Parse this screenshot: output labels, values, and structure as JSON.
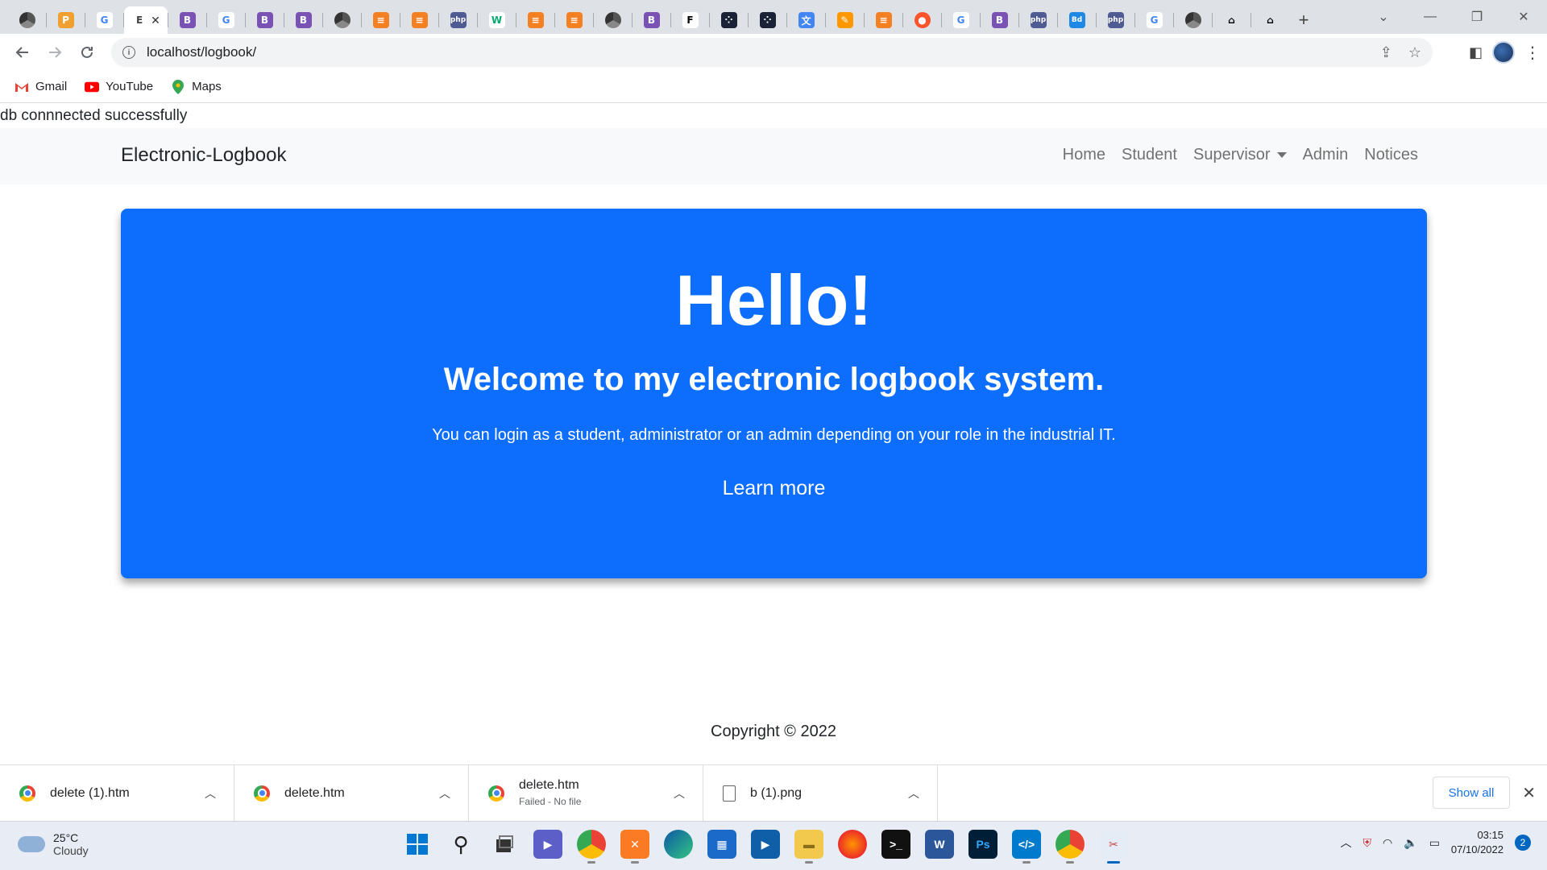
{
  "browser": {
    "tabs": [
      {
        "icon": "chrome-icon",
        "active": false
      },
      {
        "icon": "phpmyadmin-icon",
        "active": false
      },
      {
        "icon": "google-icon",
        "active": false
      },
      {
        "icon": "page-icon",
        "label": "E",
        "active": true
      },
      {
        "icon": "bootstrap-icon",
        "active": false
      },
      {
        "icon": "google-icon",
        "active": false
      },
      {
        "icon": "bootstrap-icon",
        "active": false
      },
      {
        "icon": "bootstrap-icon",
        "active": false
      },
      {
        "icon": "chrome-icon",
        "active": false
      },
      {
        "icon": "stackoverflow-icon",
        "active": false
      },
      {
        "icon": "stackoverflow-icon",
        "active": false
      },
      {
        "icon": "php-icon",
        "active": false
      },
      {
        "icon": "w3schools-icon",
        "active": false
      },
      {
        "icon": "stackoverflow-icon",
        "active": false
      },
      {
        "icon": "stackoverflow-icon",
        "active": false
      },
      {
        "icon": "chrome-icon",
        "active": false
      },
      {
        "icon": "bootstrap-icon",
        "active": false
      },
      {
        "icon": "f-icon",
        "active": false
      },
      {
        "icon": "dark-icon",
        "active": false
      },
      {
        "icon": "dark-icon",
        "active": false
      },
      {
        "icon": "translate-icon",
        "active": false
      },
      {
        "icon": "pencil-icon",
        "active": false
      },
      {
        "icon": "stackoverflow-icon",
        "active": false
      },
      {
        "icon": "brave-icon",
        "active": false
      },
      {
        "icon": "google-icon",
        "active": false
      },
      {
        "icon": "bootstrap-icon",
        "active": false
      },
      {
        "icon": "php-icon",
        "active": false
      },
      {
        "icon": "bd-icon",
        "active": false
      },
      {
        "icon": "php-icon",
        "active": false
      },
      {
        "icon": "google-icon",
        "active": false
      },
      {
        "icon": "chrome-icon",
        "active": false
      },
      {
        "icon": "home-icon",
        "active": false
      },
      {
        "icon": "home-icon",
        "active": false
      }
    ],
    "url": "localhost/logbook/",
    "bookmarks": [
      {
        "label": "Gmail",
        "icon": "gmail-icon"
      },
      {
        "label": "YouTube",
        "icon": "youtube-icon"
      },
      {
        "label": "Maps",
        "icon": "maps-icon"
      }
    ]
  },
  "page": {
    "db_message": "db connnected successfully",
    "brand": "Electronic-Logbook",
    "nav": {
      "home": "Home",
      "student": "Student",
      "supervisor": "Supervisor",
      "admin": "Admin",
      "notices": "Notices"
    },
    "hero": {
      "title": "Hello!",
      "subtitle": "Welcome to my electronic logbook system.",
      "lead": "You can login as a student, administrator or an admin depending on your role in the industrial IT.",
      "learn_more": "Learn more"
    },
    "footer": "Copyright © 2022"
  },
  "downloads": {
    "items": [
      {
        "name": "delete (1).htm",
        "status": "",
        "icon": "chrome-icon"
      },
      {
        "name": "delete.htm",
        "status": "",
        "icon": "chrome-icon"
      },
      {
        "name": "delete.htm",
        "status": "Failed - No file",
        "icon": "chrome-icon"
      },
      {
        "name": "b (1).png",
        "status": "",
        "icon": "file-icon"
      }
    ],
    "show_all": "Show all"
  },
  "taskbar": {
    "weather_temp": "25°C",
    "weather_desc": "Cloudy",
    "time": "03:15",
    "date": "07/10/2022",
    "notifications": "2"
  },
  "colors": {
    "primary": "#0d6efd",
    "navbar_bg": "#f8f9fa",
    "tab_strip": "#dee1e6"
  }
}
